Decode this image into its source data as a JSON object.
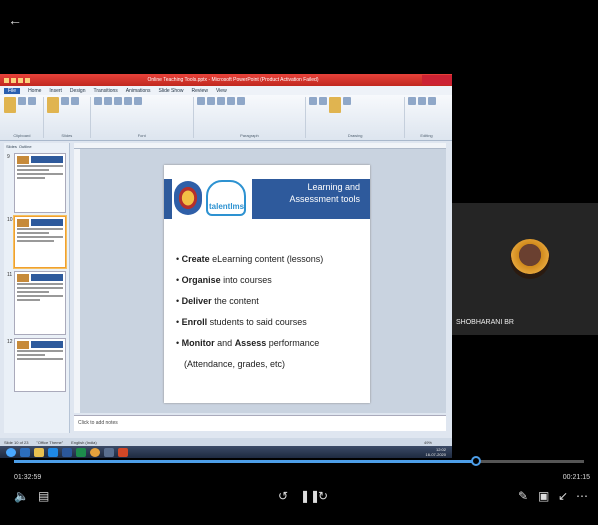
{
  "back_icon": "arrow-left-icon",
  "powerpoint": {
    "window_title": "Online Teaching Tools.pptx - Microsoft PowerPoint (Product Activation Failed)",
    "menu": [
      "File",
      "Home",
      "Insert",
      "Design",
      "Transitions",
      "Animations",
      "Slide Show",
      "Review",
      "View"
    ],
    "ribbon_groups": [
      "Clipboard",
      "Slides",
      "Font",
      "Paragraph",
      "Drawing",
      "Editing"
    ],
    "pane_tabs": [
      "Slides",
      "Outline"
    ],
    "slide_numbers": [
      "9",
      "10",
      "11",
      "12"
    ],
    "notes_placeholder": "Click to add notes",
    "status": [
      "Slide 10 of 23",
      "\"Office Theme\"",
      "English (India)"
    ],
    "zoom": "49%"
  },
  "slide": {
    "title": "Learning and Assessment tools",
    "logo_text": "talentlms",
    "bullets": [
      {
        "bold": "Create",
        "rest": " eLearning content (lessons)"
      },
      {
        "bold": "Organise",
        "rest": " into courses"
      },
      {
        "bold": "Deliver",
        "rest": " the content"
      },
      {
        "bold": "Enroll",
        "rest": " students to said courses"
      },
      {
        "bold": "Monitor",
        "mid": " and ",
        "bold2": "Assess",
        "rest": " performance"
      }
    ],
    "sub_bullet": "(Attendance, grades, etc)"
  },
  "taskbar": {
    "clock_time": "12:02",
    "clock_date": "16-07-2020"
  },
  "participant": {
    "name": "SHOBHARANI BR"
  },
  "player": {
    "elapsed": "01:32:59",
    "remaining": "00:21:15",
    "progress": 0.81
  },
  "icons": {
    "left": [
      "volume-icon",
      "captions-icon"
    ],
    "center": [
      "rewind-10-icon",
      "pause-icon",
      "forward-10-icon"
    ],
    "right": [
      "edit-pen-icon",
      "picture-in-picture-icon",
      "minimize-icon",
      "more-icon"
    ]
  }
}
